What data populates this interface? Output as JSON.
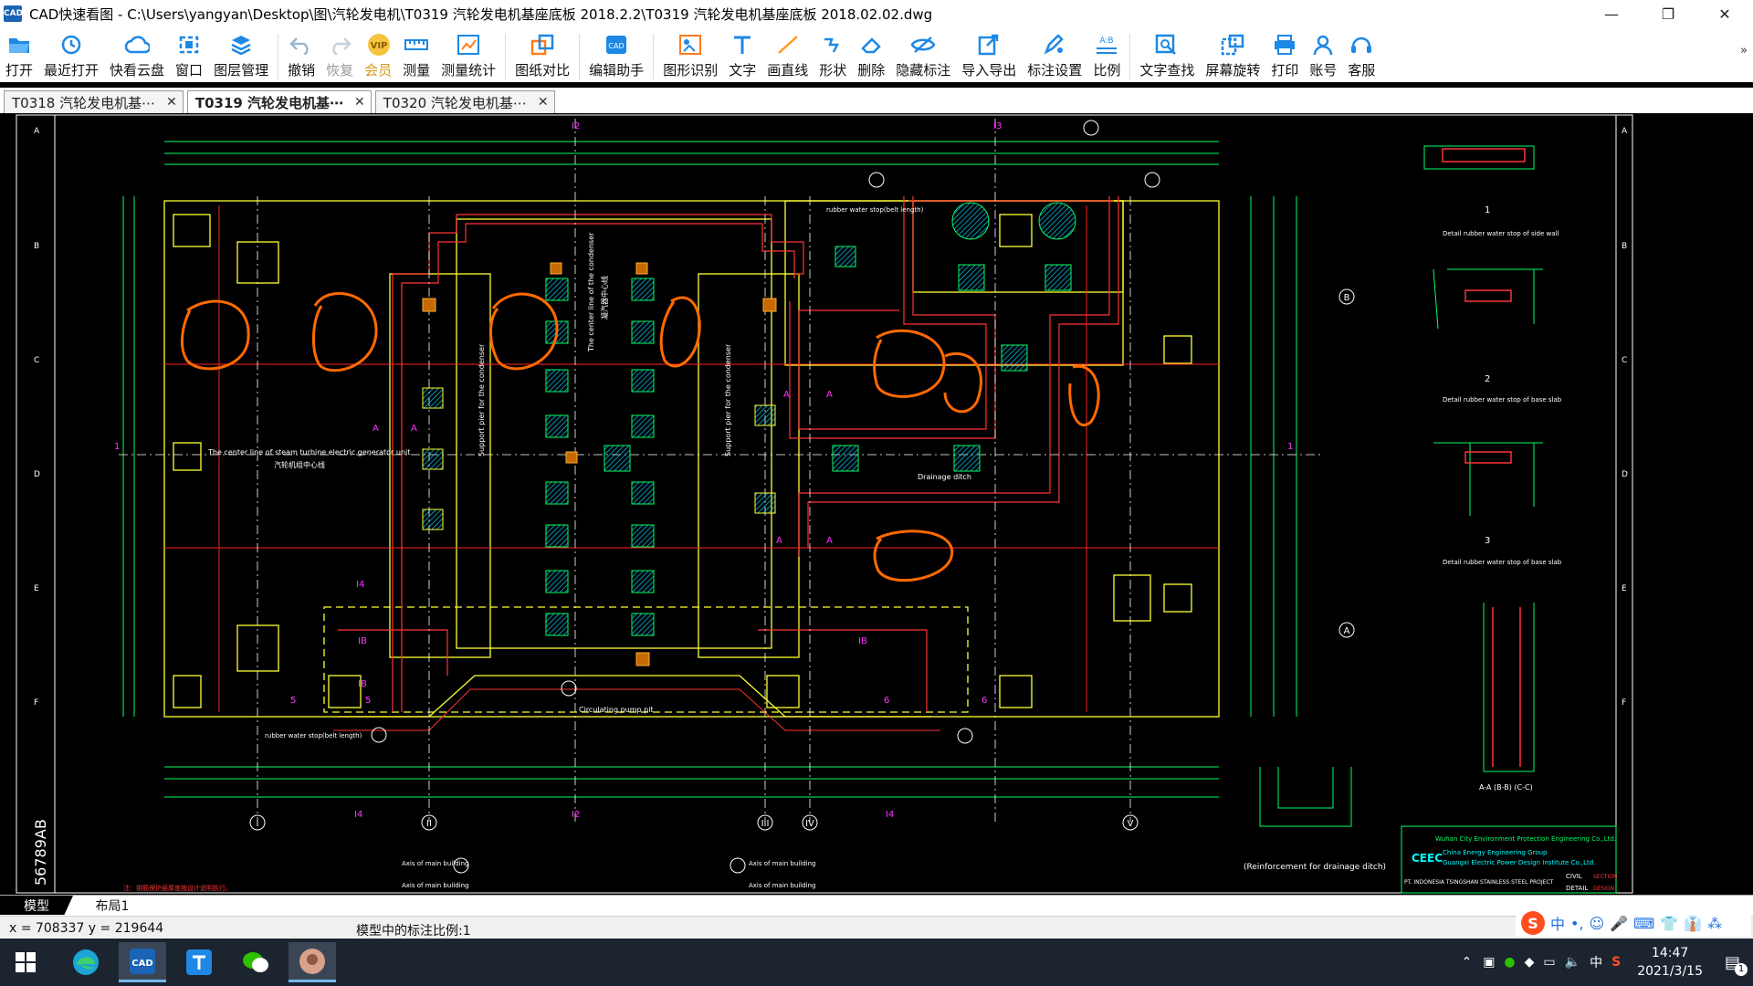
{
  "titlebar": {
    "logo_text": "CAD",
    "title": "CAD快速看图 - C:\\Users\\yangyan\\Desktop\\图\\汽轮发电机\\T0319 汽轮发电机基座底板 2018.2.2\\T0319 汽轮发电机基座底板 2018.02.02.dwg",
    "minimize": "—",
    "maximize": "❐",
    "close": "✕"
  },
  "toolbar": {
    "open": "打开",
    "recent": "最近打开",
    "cloud": "快看云盘",
    "window": "窗口",
    "layers": "图层管理",
    "undo": "撤销",
    "redo": "恢复",
    "vip": "会员",
    "measure": "测量",
    "measure_stats": "测量统计",
    "compare": "图纸对比",
    "edit_helper": "编辑助手",
    "shape_recog": "图形识别",
    "text": "文字",
    "line": "画直线",
    "shape": "形状",
    "delete": "删除",
    "hide_marks": "隐藏标注",
    "import_export": "导入导出",
    "mark_settings": "标注设置",
    "scale": "比例",
    "text_search": "文字查找",
    "rotate": "屏幕旋转",
    "print": "打印",
    "account": "账号",
    "service": "客服",
    "more": "»",
    "vip_badge": "VIP",
    "scale_badge": "A:B"
  },
  "tabs": [
    {
      "label": "T0318 汽轮发电机基⋯",
      "close": "✕"
    },
    {
      "label": "T0319 汽轮发电机基⋯",
      "close": "✕"
    },
    {
      "label": "T0320 汽轮发电机基⋯",
      "close": "✕"
    }
  ],
  "drawing": {
    "border_row_letters": [
      "A",
      "B",
      "C",
      "D",
      "E",
      "F"
    ],
    "axis_letter_left": "1",
    "axis_letter_right": "1",
    "top_axis_labels": [
      "I2",
      "I3"
    ],
    "bottom_axis_labels": [
      "I4",
      "I2",
      "I4"
    ],
    "circle_labels": [
      "I",
      "II",
      "III",
      "IV",
      "V"
    ],
    "grid_letters": [
      "B",
      "A"
    ],
    "center_line_text": "The center line of steam turbine electric generator unit",
    "center_line_cn": "汽轮机组中心线",
    "condenser_text": "The center line of the condenser",
    "condenser_cn": "凝汽器中心线",
    "support_left": "Support pier for the condenser",
    "support_right": "Support pier for the condenser",
    "section_marks": [
      "A",
      "A",
      "A",
      "A",
      "A",
      "A"
    ],
    "label_i4": "I4",
    "label_ib": [
      "IB",
      "IB",
      "IB"
    ],
    "label_5": [
      "5",
      "5",
      "6",
      "6"
    ],
    "pump_pit_text": "Circulating pump pit",
    "drainage_text": "Drainage ditch",
    "vert_side_text": "56789AB",
    "detail1_caption": "Detail rubber water stop of side wall",
    "detail2_caption": "Detail rubber water stop of base slab",
    "detail3_caption": "Detail rubber water stop of base slab",
    "detail_nums": [
      "1",
      "2",
      "3"
    ],
    "section_label": "A-A\n(B-B)\n(C-C)",
    "ditch_caption": "(Reinforcement for drainage ditch)",
    "company_line1": "Wuhan City Environment Protection Engineering Co.,Ltd.",
    "company_line2": "China Energy Engineering Group",
    "company_line3": "Guangxi Electric Power Design Institute Co.,Ltd.",
    "company_logo": "CEEC",
    "project_text": "PT. INDONESIA TSINGSHAN STAINLESS STEEL PROJECT",
    "civil_text": "CIVIL",
    "detail_text": "DETAIL",
    "section_text": "SECTION",
    "design_text": "DESIGN",
    "note_red": "注：钢筋保护层厚度按设计说明执行。",
    "axis_dim_notes": [
      "Axis of main building",
      "Axis of main building",
      "Axis of main building",
      "Axis of main building"
    ],
    "rubber_text": "rubber water stop(belt length)",
    "waterstop_top": "rubber water stop(belt length)"
  },
  "layout_tabs": {
    "model": "模型",
    "layout1": "布局1"
  },
  "status": {
    "coords": "x = 708337  y = 219644",
    "scale_text": "模型中的标注比例:1"
  },
  "ime": {
    "logo": "S",
    "items": [
      "中",
      "•,",
      "☺",
      "🎤",
      "⌨",
      "👕",
      "👔",
      "⁂"
    ]
  },
  "taskbar": {
    "time": "14:47",
    "date": "2021/3/15",
    "ime_lang": "中",
    "notif_count": "1"
  }
}
